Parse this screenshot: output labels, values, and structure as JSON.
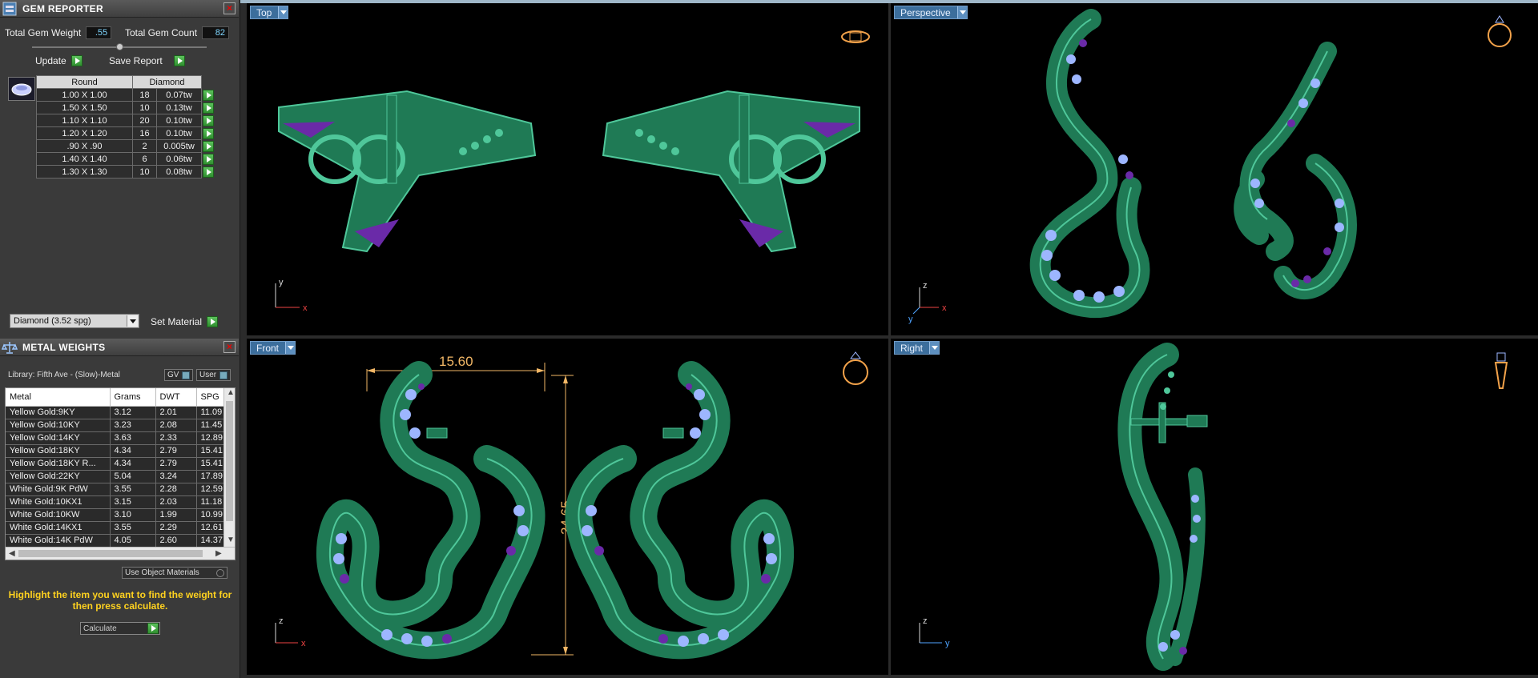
{
  "gem_reporter": {
    "title": "GEM REPORTER",
    "total_weight_label": "Total Gem Weight",
    "total_weight_value": ".55",
    "total_count_label": "Total Gem Count",
    "total_count_value": "82",
    "update_label": "Update",
    "save_report_label": "Save Report",
    "table_header": {
      "shape": "Round",
      "type": "Diamond"
    },
    "rows": [
      {
        "size": "1.00 X 1.00",
        "count": "18",
        "weight": "0.07tw"
      },
      {
        "size": "1.50 X 1.50",
        "count": "10",
        "weight": "0.13tw"
      },
      {
        "size": "1.10 X 1.10",
        "count": "20",
        "weight": "0.10tw"
      },
      {
        "size": "1.20 X 1.20",
        "count": "16",
        "weight": "0.10tw"
      },
      {
        "size": ".90 X .90",
        "count": "2",
        "weight": "0.005tw"
      },
      {
        "size": "1.40 X 1.40",
        "count": "6",
        "weight": "0.06tw"
      },
      {
        "size": "1.30 X 1.30",
        "count": "10",
        "weight": "0.08tw"
      }
    ],
    "material_select": "Diamond    (3.52 spg)",
    "set_material_label": "Set Material"
  },
  "metal_weights": {
    "title": "METAL WEIGHTS",
    "library": "Library: Fifth Ave - (Slow)-Metal",
    "gv_label": "GV",
    "user_label": "User",
    "columns": [
      "Metal",
      "Grams",
      "DWT",
      "SPG"
    ],
    "rows": [
      [
        "Yellow Gold:9KY",
        "3.12",
        "2.01",
        "11.09"
      ],
      [
        "Yellow Gold:10KY",
        "3.23",
        "2.08",
        "11.45"
      ],
      [
        "Yellow Gold:14KY",
        "3.63",
        "2.33",
        "12.89"
      ],
      [
        "Yellow Gold:18KY",
        "4.34",
        "2.79",
        "15.41"
      ],
      [
        "Yellow Gold:18KY R...",
        "4.34",
        "2.79",
        "15.41"
      ],
      [
        "Yellow Gold:22KY",
        "5.04",
        "3.24",
        "17.89"
      ],
      [
        "White Gold:9K PdW",
        "3.55",
        "2.28",
        "12.59"
      ],
      [
        "White Gold:10KX1",
        "3.15",
        "2.03",
        "11.18"
      ],
      [
        "White Gold:10KW",
        "3.10",
        "1.99",
        "10.99"
      ],
      [
        "White Gold:14KX1",
        "3.55",
        "2.29",
        "12.61"
      ],
      [
        "White Gold:14K PdW",
        "4.05",
        "2.60",
        "14.37"
      ]
    ],
    "use_object_materials": "Use Object Materials",
    "hint": "Highlight the item you want to find the weight for then press calculate.",
    "calculate_label": "Calculate"
  },
  "viewports": {
    "top": "Top",
    "perspective": "Perspective",
    "front": "Front",
    "right": "Right",
    "dim_width": "15.60",
    "dim_height": "24.65",
    "axis": {
      "x": "x",
      "y": "y",
      "z": "z"
    }
  },
  "colors": {
    "metal": "#1f7a55",
    "metal_edge": "#4fc79a",
    "gem": "#9db6ff",
    "gem_dark": "#6a2aa8",
    "dimension": "#f2b766"
  }
}
